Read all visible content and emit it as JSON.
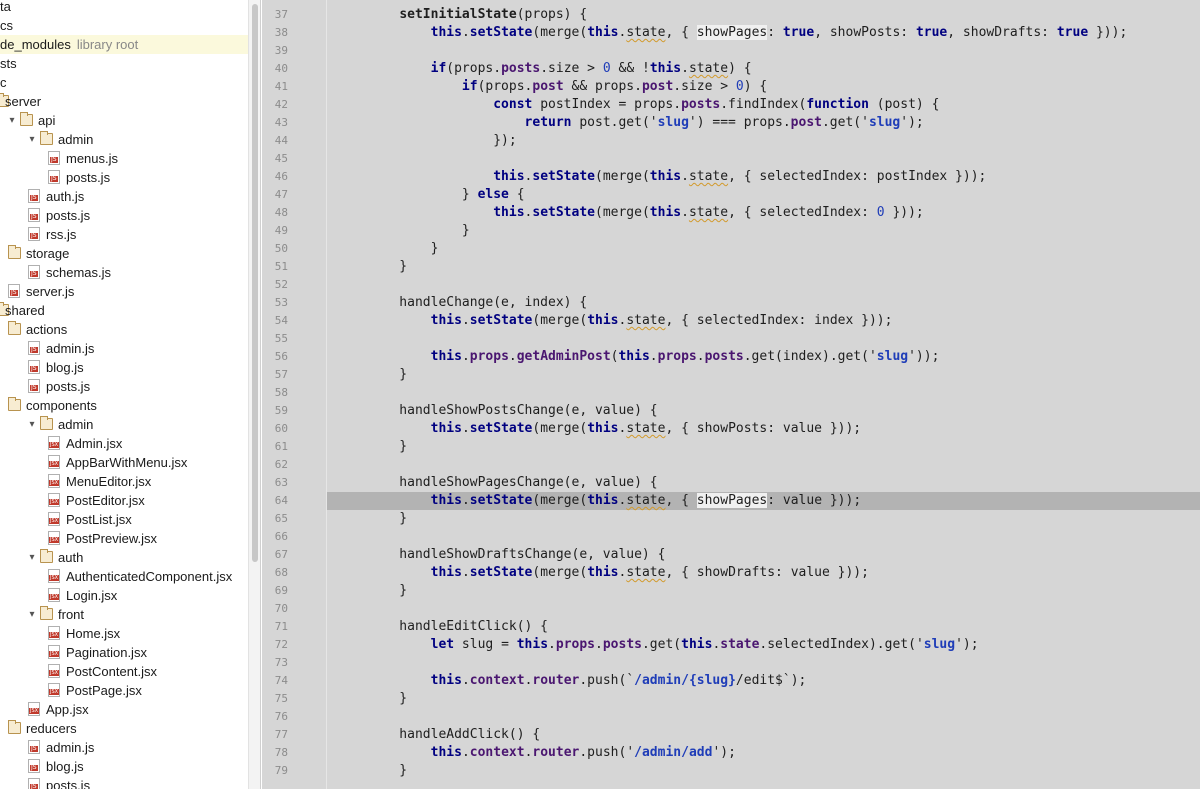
{
  "tree": {
    "items": [
      {
        "label": "ta",
        "extra": "",
        "indent": 0,
        "kind": "none",
        "arrow": ""
      },
      {
        "label": "cs",
        "extra": "",
        "indent": 0,
        "kind": "none",
        "arrow": ""
      },
      {
        "label": "de_modules",
        "extra": "library root",
        "indent": 0,
        "kind": "none",
        "arrow": "",
        "highlight": true
      },
      {
        "label": "sts",
        "extra": "",
        "indent": 0,
        "kind": "none",
        "arrow": ""
      },
      {
        "label": "c",
        "extra": "",
        "indent": 0,
        "kind": "none",
        "arrow": ""
      },
      {
        "label": "server",
        "extra": "",
        "indent": 0,
        "kind": "folder",
        "arrow": ""
      },
      {
        "label": "api",
        "extra": "",
        "indent": 1,
        "kind": "folder",
        "arrow": "▾"
      },
      {
        "label": "admin",
        "extra": "",
        "indent": 2,
        "kind": "folder",
        "arrow": "▾"
      },
      {
        "label": "menus.js",
        "extra": "",
        "indent": 3,
        "kind": "js",
        "arrow": ""
      },
      {
        "label": "posts.js",
        "extra": "",
        "indent": 3,
        "kind": "js",
        "arrow": ""
      },
      {
        "label": "auth.js",
        "extra": "",
        "indent": 2,
        "kind": "js",
        "arrow": ""
      },
      {
        "label": "posts.js",
        "extra": "",
        "indent": 2,
        "kind": "js",
        "arrow": ""
      },
      {
        "label": "rss.js",
        "extra": "",
        "indent": 2,
        "kind": "js",
        "arrow": ""
      },
      {
        "label": "storage",
        "extra": "",
        "indent": 1,
        "kind": "folder",
        "arrow": ""
      },
      {
        "label": "schemas.js",
        "extra": "",
        "indent": 2,
        "kind": "js",
        "arrow": ""
      },
      {
        "label": "server.js",
        "extra": "",
        "indent": 1,
        "kind": "js",
        "arrow": ""
      },
      {
        "label": "shared",
        "extra": "",
        "indent": 0,
        "kind": "folder",
        "arrow": ""
      },
      {
        "label": "actions",
        "extra": "",
        "indent": 1,
        "kind": "folder",
        "arrow": ""
      },
      {
        "label": "admin.js",
        "extra": "",
        "indent": 2,
        "kind": "js",
        "arrow": ""
      },
      {
        "label": "blog.js",
        "extra": "",
        "indent": 2,
        "kind": "js",
        "arrow": ""
      },
      {
        "label": "posts.js",
        "extra": "",
        "indent": 2,
        "kind": "js",
        "arrow": ""
      },
      {
        "label": "components",
        "extra": "",
        "indent": 1,
        "kind": "folder",
        "arrow": ""
      },
      {
        "label": "admin",
        "extra": "",
        "indent": 2,
        "kind": "folder",
        "arrow": "▾"
      },
      {
        "label": "Admin.jsx",
        "extra": "",
        "indent": 3,
        "kind": "jsx",
        "arrow": ""
      },
      {
        "label": "AppBarWithMenu.jsx",
        "extra": "",
        "indent": 3,
        "kind": "jsx",
        "arrow": ""
      },
      {
        "label": "MenuEditor.jsx",
        "extra": "",
        "indent": 3,
        "kind": "jsx",
        "arrow": ""
      },
      {
        "label": "PostEditor.jsx",
        "extra": "",
        "indent": 3,
        "kind": "jsx",
        "arrow": ""
      },
      {
        "label": "PostList.jsx",
        "extra": "",
        "indent": 3,
        "kind": "jsx",
        "arrow": ""
      },
      {
        "label": "PostPreview.jsx",
        "extra": "",
        "indent": 3,
        "kind": "jsx",
        "arrow": ""
      },
      {
        "label": "auth",
        "extra": "",
        "indent": 2,
        "kind": "folder",
        "arrow": "▾"
      },
      {
        "label": "AuthenticatedComponent.jsx",
        "extra": "",
        "indent": 3,
        "kind": "jsx",
        "arrow": ""
      },
      {
        "label": "Login.jsx",
        "extra": "",
        "indent": 3,
        "kind": "jsx",
        "arrow": ""
      },
      {
        "label": "front",
        "extra": "",
        "indent": 2,
        "kind": "folder",
        "arrow": "▾"
      },
      {
        "label": "Home.jsx",
        "extra": "",
        "indent": 3,
        "kind": "jsx",
        "arrow": ""
      },
      {
        "label": "Pagination.jsx",
        "extra": "",
        "indent": 3,
        "kind": "jsx",
        "arrow": ""
      },
      {
        "label": "PostContent.jsx",
        "extra": "",
        "indent": 3,
        "kind": "jsx",
        "arrow": ""
      },
      {
        "label": "PostPage.jsx",
        "extra": "",
        "indent": 3,
        "kind": "jsx",
        "arrow": ""
      },
      {
        "label": "App.jsx",
        "extra": "",
        "indent": 2,
        "kind": "jsx",
        "arrow": ""
      },
      {
        "label": "reducers",
        "extra": "",
        "indent": 1,
        "kind": "folder",
        "arrow": ""
      },
      {
        "label": "admin.js",
        "extra": "",
        "indent": 2,
        "kind": "js",
        "arrow": ""
      },
      {
        "label": "blog.js",
        "extra": "",
        "indent": 2,
        "kind": "js",
        "arrow": ""
      },
      {
        "label": "posts.js",
        "extra": "",
        "indent": 2,
        "kind": "js",
        "arrow": ""
      }
    ]
  },
  "editor": {
    "current_line": 64,
    "lines": [
      {
        "n": "37",
        "t": "    [setInitialState](props) {"
      },
      {
        "n": "38",
        "t": "        {this}.{setState}(merge({this}.~state~, { ^showPages^: {true}, showPosts: {true}, showDrafts: {true} }));"
      },
      {
        "n": "39",
        "t": ""
      },
      {
        "n": "40",
        "t": "        {if}(props.@posts@.size > #0# && !{this}.~state~) {"
      },
      {
        "n": "41",
        "t": "            {if}(props.@post@ && props.@post@.size > #0#) {"
      },
      {
        "n": "42",
        "t": "                {const} postIndex = props.@posts@.findIndex({function} (post) {"
      },
      {
        "n": "43",
        "t": "                    {return} post.get('$slug$') === props.@post@.get('$slug$');"
      },
      {
        "n": "44",
        "t": "                });"
      },
      {
        "n": "45",
        "t": ""
      },
      {
        "n": "46",
        "t": "                {this}.{setState}(merge({this}.~state~, { selectedIndex: postIndex }));"
      },
      {
        "n": "47",
        "t": "            } {else} {"
      },
      {
        "n": "48",
        "t": "                {this}.{setState}(merge({this}.~state~, { selectedIndex: #0# }));"
      },
      {
        "n": "49",
        "t": "            }"
      },
      {
        "n": "50",
        "t": "        }"
      },
      {
        "n": "51",
        "t": "    }"
      },
      {
        "n": "52",
        "t": ""
      },
      {
        "n": "53",
        "t": "    handleChange(e, index) {"
      },
      {
        "n": "54",
        "t": "        {this}.{setState}(merge({this}.~state~, { selectedIndex: index }));"
      },
      {
        "n": "55",
        "t": ""
      },
      {
        "n": "56",
        "t": "        {this}.@props@.@getAdminPost@({this}.@props@.@posts@.get(index).get('$slug$'));"
      },
      {
        "n": "57",
        "t": "    }"
      },
      {
        "n": "58",
        "t": ""
      },
      {
        "n": "59",
        "t": "    handleShowPostsChange(e, value) {"
      },
      {
        "n": "60",
        "t": "        {this}.{setState}(merge({this}.~state~, { showPosts: value }));"
      },
      {
        "n": "61",
        "t": "    }"
      },
      {
        "n": "62",
        "t": ""
      },
      {
        "n": "63",
        "t": "    handleShowPagesChange(e, value) {"
      },
      {
        "n": "64",
        "t": "        {this}.{setState}(merge({this}.~state~, { ^showPages^: value }));"
      },
      {
        "n": "65",
        "t": "    }"
      },
      {
        "n": "66",
        "t": ""
      },
      {
        "n": "67",
        "t": "    handleShowDraftsChange(e, value) {"
      },
      {
        "n": "68",
        "t": "        {this}.{setState}(merge({this}.~state~, { showDrafts: value }));"
      },
      {
        "n": "69",
        "t": "    }"
      },
      {
        "n": "70",
        "t": ""
      },
      {
        "n": "71",
        "t": "    handleEditClick() {"
      },
      {
        "n": "72",
        "t": "        {let} slug = {this}.@props@.@posts@.get({this}.@state@.selectedIndex).get('$slug$');"
      },
      {
        "n": "73",
        "t": ""
      },
      {
        "n": "74",
        "t": "        {this}.@context@.@router@.push(`$/admin/$${slug}$/edit$`);"
      },
      {
        "n": "75",
        "t": "    }"
      },
      {
        "n": "76",
        "t": ""
      },
      {
        "n": "77",
        "t": "    handleAddClick() {"
      },
      {
        "n": "78",
        "t": "        {this}.@context@.@router@.push('$/admin/add$');"
      },
      {
        "n": "79",
        "t": "    }"
      }
    ]
  },
  "colors": {
    "editor_bg": "#d6d6d6",
    "current_line_bg": "#b3b3b3",
    "keyword": "#000080",
    "string": "#1f3db8",
    "library_root_highlight": "#fbf9dc"
  }
}
